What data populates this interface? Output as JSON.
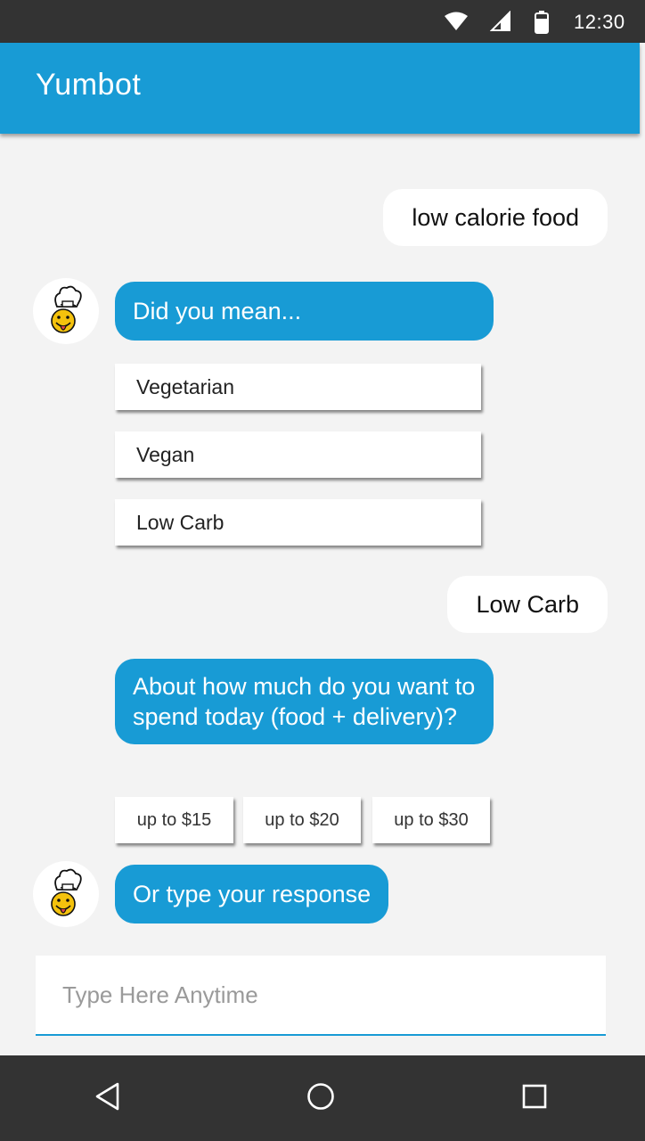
{
  "status_bar": {
    "time": "12:30",
    "icons": [
      "wifi-icon",
      "cell-signal-icon",
      "battery-icon"
    ]
  },
  "app_bar": {
    "title": "Yumbot",
    "color": "#189bd5"
  },
  "chat": {
    "user_message_1": "low calorie food",
    "bot_message_1": "Did you mean...",
    "options": [
      "Vegetarian",
      "Vegan",
      "Low Carb"
    ],
    "user_message_2": "Low Carb",
    "bot_message_2": "About how much do you want to spend today (food + delivery)?",
    "price_options": [
      "up to $15",
      "up to $20",
      "up to $30"
    ],
    "bot_message_3": "Or type your response",
    "avatar_icon": "chef-emoji-icon"
  },
  "input": {
    "placeholder": "Type Here Anytime",
    "value": ""
  },
  "nav_bar": {
    "icons": [
      "back-icon",
      "home-icon",
      "recent-apps-icon"
    ]
  },
  "colors": {
    "accent": "#189bd5",
    "background": "#f3f3f3",
    "bars": "#333333"
  }
}
